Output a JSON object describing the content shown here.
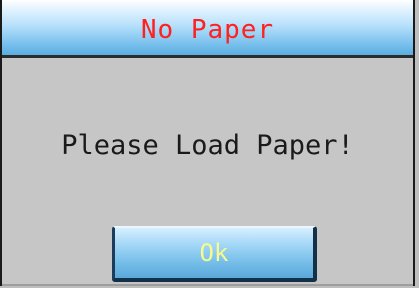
{
  "dialog": {
    "title": "No Paper",
    "message": "Please Load Paper!",
    "ok_label": "Ok"
  },
  "colors": {
    "title_text": "#ff2020",
    "button_text": "#f6fb8c",
    "body_background": "#c6c6c6",
    "accent_blue": "#74bde9"
  }
}
